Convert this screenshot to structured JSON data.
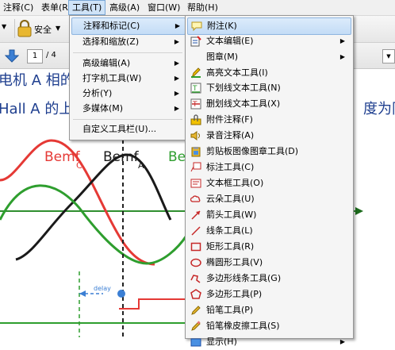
{
  "menubar": {
    "items": [
      {
        "label": "注释(C)"
      },
      {
        "label": "表单(R)"
      },
      {
        "label": "工具(T)"
      },
      {
        "label": "高级(A)"
      },
      {
        "label": "窗口(W)"
      },
      {
        "label": "帮助(H)"
      }
    ]
  },
  "toolbar": {
    "security_label": "安全",
    "page_current": "1",
    "page_total": "/ 4"
  },
  "document": {
    "line1": "电机 A 相的",
    "line2": "Hall A 的上",
    "line3": "度为同",
    "chart_labels": [
      "Bemf",
      "C",
      "Bemf",
      "A",
      "Be"
    ],
    "delay_label": "delay"
  },
  "tools_menu": {
    "items": [
      {
        "label": "注释和标记(C)",
        "submenu": true
      },
      {
        "label": "选择和缩放(Z)",
        "submenu": true
      },
      {
        "label": "高级编辑(A)",
        "submenu": true
      },
      {
        "label": "打字机工具(W)",
        "submenu": true
      },
      {
        "label": "分析(Y)",
        "submenu": true
      },
      {
        "label": "多媒体(M)",
        "submenu": true
      },
      {
        "label": "自定义工具栏(U)..."
      }
    ]
  },
  "annotation_menu": {
    "items": [
      {
        "label": "附注(K)",
        "icon": "note-icon"
      },
      {
        "label": "文本编辑(E)",
        "icon": "text-edit-icon",
        "submenu": true
      },
      {
        "label": "图章(M)",
        "icon": "stamp-icon",
        "submenu": true
      },
      {
        "label": "高亮文本工具(I)",
        "icon": "highlight-icon"
      },
      {
        "label": "下划线文本工具(N)",
        "icon": "underline-icon"
      },
      {
        "label": "删划线文本工具(X)",
        "icon": "strikethrough-icon"
      },
      {
        "label": "附件注释(F)",
        "icon": "attachment-icon"
      },
      {
        "label": "录音注释(A)",
        "icon": "audio-icon"
      },
      {
        "label": "剪贴板图像图章工具(D)",
        "icon": "clipboard-image-icon"
      },
      {
        "label": "标注工具(C)",
        "icon": "callout-icon"
      },
      {
        "label": "文本框工具(O)",
        "icon": "text-box-icon"
      },
      {
        "label": "云朵工具(U)",
        "icon": "cloud-icon"
      },
      {
        "label": "箭头工具(W)",
        "icon": "arrow-icon"
      },
      {
        "label": "线条工具(L)",
        "icon": "line-icon"
      },
      {
        "label": "矩形工具(R)",
        "icon": "rectangle-icon"
      },
      {
        "label": "椭圆形工具(V)",
        "icon": "ellipse-icon"
      },
      {
        "label": "多边形线条工具(G)",
        "icon": "polyline-icon"
      },
      {
        "label": "多边形工具(P)",
        "icon": "polygon-icon"
      },
      {
        "label": "铅笔工具(P)",
        "icon": "pencil-icon"
      },
      {
        "label": "铅笔橡皮擦工具(S)",
        "icon": "pencil-eraser-icon"
      },
      {
        "label": "显示(H)",
        "icon": "show-icon",
        "submenu": true
      }
    ]
  }
}
